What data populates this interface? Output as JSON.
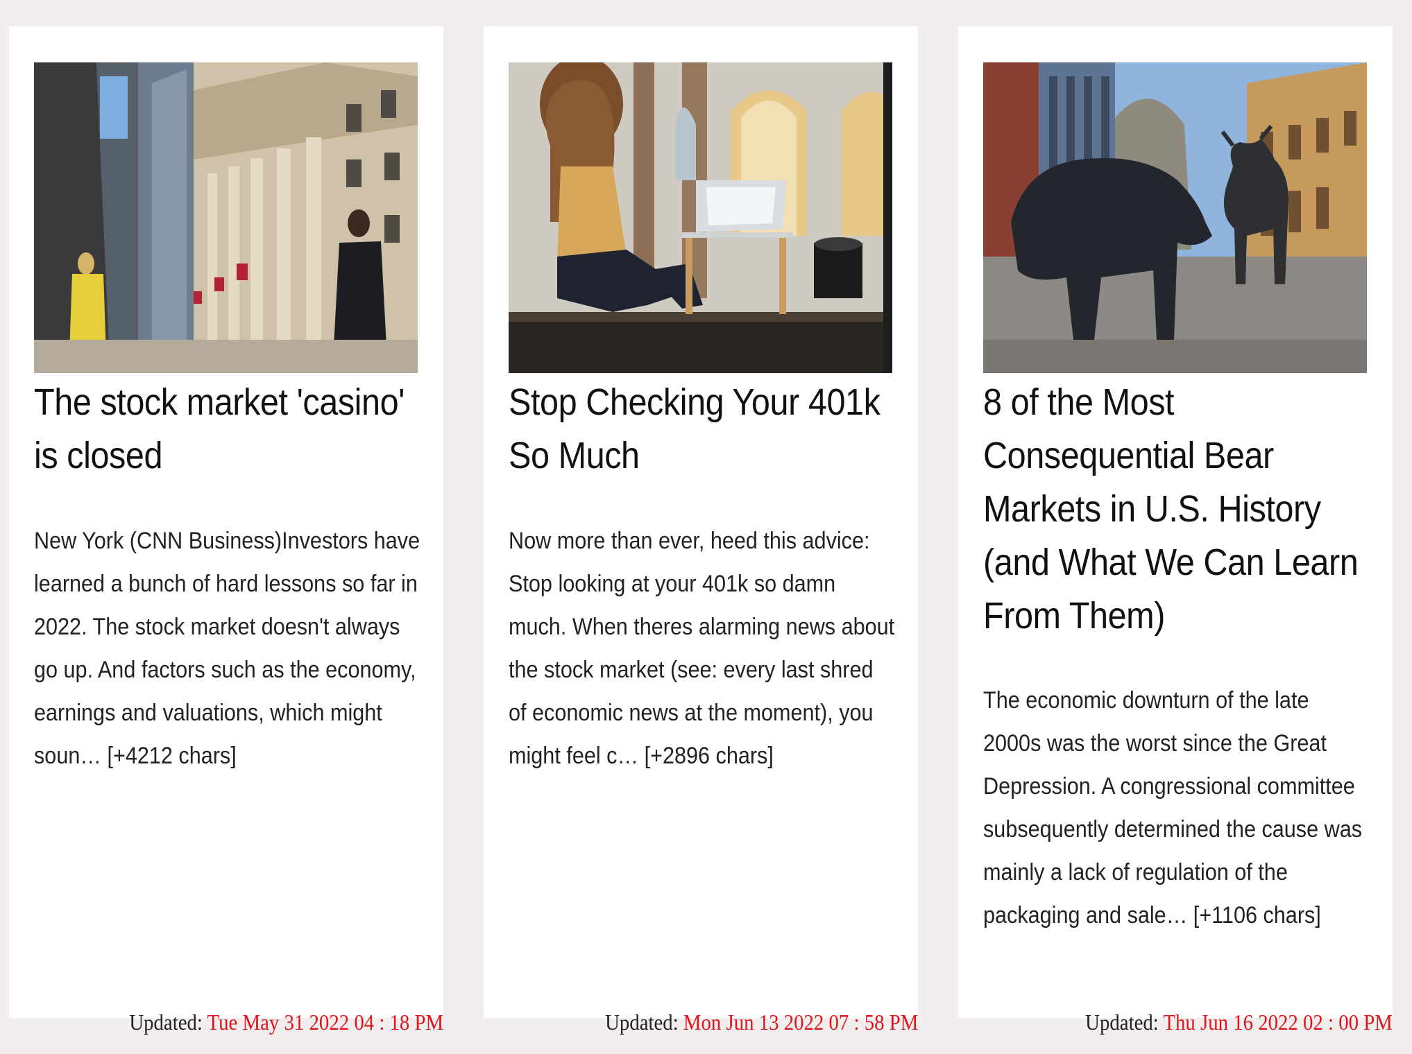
{
  "articles": [
    {
      "image_alt": "Pedestrians outside the New York Stock Exchange building",
      "title": "The stock market 'casino' is closed",
      "description": "New York (CNN Business)Investors have learned a bunch of hard lessons so far in 2022. The stock market doesn't always go up. And factors such as the economy, earnings and valuations, which might soun… [+4212 chars]",
      "updated_label": "Updated: ",
      "updated_date": "Tue May 31 2022 04 : 18 PM"
    },
    {
      "image_alt": "Woman with curly hair using a laptop by a window",
      "title": "Stop Checking Your 401k So Much",
      "description": "Now more than ever, heed this advice: Stop looking at your 401k so damn much. When theres alarming news about the stock market (see: every last shred of economic news at the moment), you might feel c… [+2896 chars]",
      "updated_label": "Updated: ",
      "updated_date": "Mon Jun 13 2022 07 : 58 PM"
    },
    {
      "image_alt": "Bear and bull statues in front of the Frankfurt stock exchange",
      "title": "8 of the Most Consequential Bear Markets in U.S. History (and What We Can Learn From Them)",
      "description": "The economic downturn of the late 2000s was the worst since the Great Depression. A congressional committee subsequently determined the cause was mainly a lack of regulation of the packaging and sale… [+1106 chars]",
      "updated_label": "Updated: ",
      "updated_date": "Thu Jun 16 2022 02 : 00 PM"
    }
  ],
  "colors": {
    "page_background": "#f3eeee",
    "card_background": "#ffffff",
    "date_accent": "#e0141b"
  }
}
